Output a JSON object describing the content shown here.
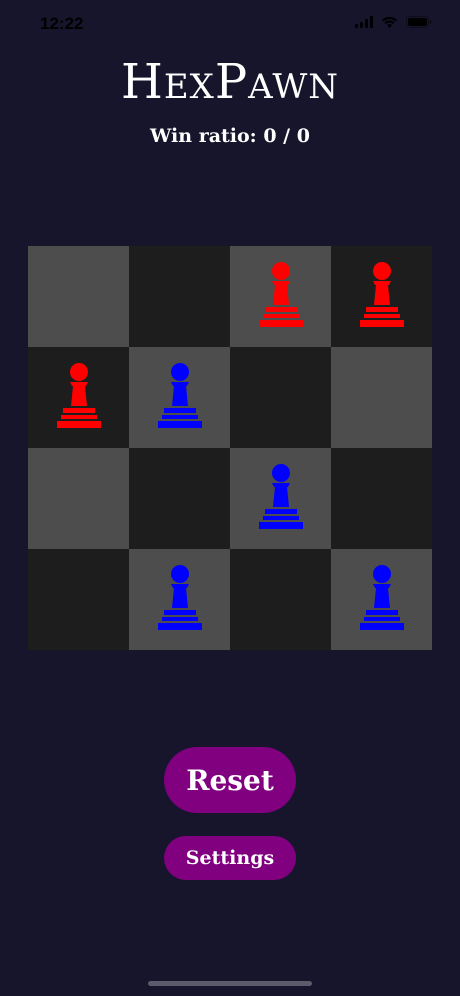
{
  "status_bar": {
    "time": "12:22",
    "icons": [
      "signal-icon",
      "wifi-icon",
      "battery-icon"
    ]
  },
  "title": "HexPawn",
  "win_ratio": "Win ratio: 0 / 0",
  "board": {
    "rows": 4,
    "cols": 4,
    "cells": [
      [
        {
          "shade": "light",
          "piece": null
        },
        {
          "shade": "dark",
          "piece": null
        },
        {
          "shade": "light",
          "piece": "red"
        },
        {
          "shade": "dark",
          "piece": "red"
        }
      ],
      [
        {
          "shade": "dark",
          "piece": "red"
        },
        {
          "shade": "light",
          "piece": "blue"
        },
        {
          "shade": "dark",
          "piece": null
        },
        {
          "shade": "light",
          "piece": null
        }
      ],
      [
        {
          "shade": "light",
          "piece": null
        },
        {
          "shade": "dark",
          "piece": null
        },
        {
          "shade": "light",
          "piece": "blue"
        },
        {
          "shade": "dark",
          "piece": null
        }
      ],
      [
        {
          "shade": "dark",
          "piece": null
        },
        {
          "shade": "light",
          "piece": "blue"
        },
        {
          "shade": "dark",
          "piece": null
        },
        {
          "shade": "light",
          "piece": "blue"
        }
      ]
    ]
  },
  "buttons": {
    "reset_label": "Reset",
    "settings_label": "Settings"
  },
  "colors": {
    "background": "#16152b",
    "button": "#800080",
    "red_pawn": "#ff0000",
    "blue_pawn": "#0000ff",
    "light_square": "#4d4d4d",
    "dark_square": "#1d1d1d"
  }
}
